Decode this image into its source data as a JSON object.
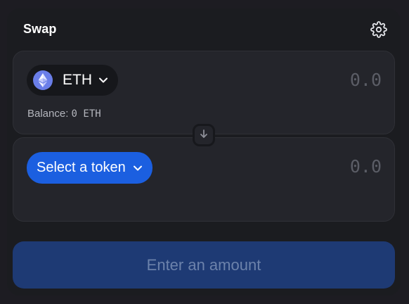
{
  "header": {
    "title": "Swap",
    "settings_icon": "gear-icon"
  },
  "from_panel": {
    "token": {
      "symbol": "ETH",
      "icon": "ethereum-icon",
      "dropdown_icon": "chevron-down-icon"
    },
    "amount_placeholder": "0.0",
    "balance": {
      "label": "Balance:",
      "value": "0 ETH"
    }
  },
  "switch_button": {
    "icon": "arrow-down-icon"
  },
  "to_panel": {
    "select_token_label": "Select a token",
    "dropdown_icon": "chevron-down-icon",
    "amount_placeholder": "0.0"
  },
  "cta": {
    "label": "Enter an amount",
    "disabled": true
  },
  "colors": {
    "accent": "#1b5fe0",
    "cta_disabled_bg": "#1e3a74",
    "cta_disabled_text": "#6c82ab",
    "eth": "#6a7ee8"
  }
}
